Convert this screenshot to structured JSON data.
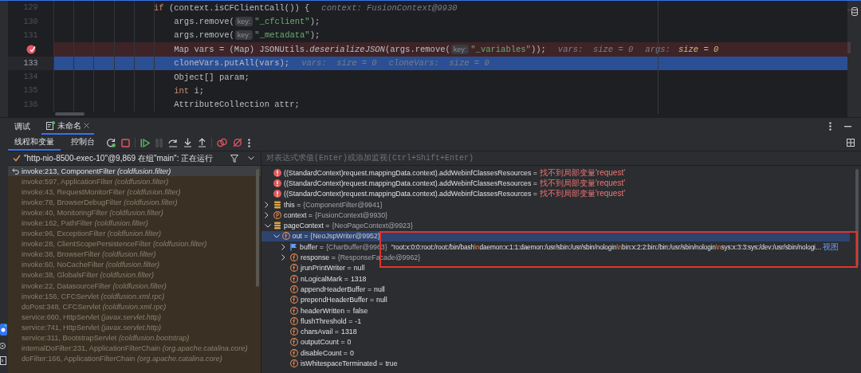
{
  "code_lines": [
    {
      "number": "129",
      "breakpoint": false,
      "current": false,
      "tokens": [
        {
          "kind": "kw",
          "text": "                    if"
        },
        {
          "kind": "plain",
          "text": " (context.isCFClientCall()) {"
        },
        {
          "kind": "inlay",
          "text": "context: FusionContext@9930"
        }
      ]
    },
    {
      "number": "130",
      "breakpoint": false,
      "current": false,
      "tokens": [
        {
          "kind": "plain",
          "text": "                        args.remove("
        },
        {
          "kind": "param",
          "text": "key:"
        },
        {
          "kind": "str",
          "text": "\"_cfclient\""
        },
        {
          "kind": "plain",
          "text": ");"
        }
      ]
    },
    {
      "number": "131",
      "breakpoint": false,
      "current": false,
      "tokens": [
        {
          "kind": "plain",
          "text": "                        args.remove("
        },
        {
          "kind": "param",
          "text": "key:"
        },
        {
          "kind": "str",
          "text": "\"_metadata\""
        },
        {
          "kind": "plain",
          "text": ");"
        }
      ]
    },
    {
      "breakpoint": true,
      "current": false,
      "tokens": [
        {
          "kind": "plain",
          "text": "                        Map vars = (Map) JSONUtils."
        },
        {
          "kind": "method",
          "text": "deserializeJSON"
        },
        {
          "kind": "plain",
          "text": "(args.remove("
        },
        {
          "kind": "param",
          "text": "key:"
        },
        {
          "kind": "str",
          "text": "\"_variables\""
        },
        {
          "kind": "plain",
          "text": "));"
        },
        {
          "kind": "inlay",
          "text": "vars:  size = 0"
        },
        {
          "kind": "inlay",
          "text": "args:"
        },
        {
          "kind": "changed",
          "text": "size = 0"
        }
      ]
    },
    {
      "number": "133",
      "breakpoint": false,
      "current": true,
      "tokens": [
        {
          "kind": "plain",
          "text": "                        cloneVars.putAll(vars);"
        },
        {
          "kind": "inlay",
          "text": "vars:  size = 0"
        },
        {
          "kind": "inlay",
          "text": "cloneVars:  size = 0"
        }
      ]
    },
    {
      "number": "134",
      "breakpoint": false,
      "current": false,
      "tokens": [
        {
          "kind": "plain",
          "text": "                        Object[] param;"
        }
      ]
    },
    {
      "number": "135",
      "breakpoint": false,
      "current": false,
      "tokens": [
        {
          "kind": "kw",
          "text": "                        int"
        },
        {
          "kind": "plain",
          "text": " i;"
        }
      ]
    },
    {
      "number": "136",
      "breakpoint": false,
      "current": false,
      "tokens": [
        {
          "kind": "plain",
          "text": "                        AttributeCollection attr;"
        }
      ]
    }
  ],
  "debug_panel": {
    "title": "调试",
    "tabs": [
      {
        "label": "未命名",
        "selected": true
      }
    ]
  },
  "view_tabs": [
    {
      "label": "线程和变量",
      "selected": true
    },
    {
      "label": "控制台",
      "selected": false
    }
  ],
  "toolbar": [
    {
      "kind": "rerun",
      "disabled": false
    },
    {
      "kind": "stop",
      "disabled": false
    },
    {
      "kind": "separator",
      "disabled": false
    },
    {
      "kind": "resume",
      "disabled": false
    },
    {
      "kind": "pause",
      "disabled": true
    },
    {
      "kind": "step_over",
      "disabled": false
    },
    {
      "kind": "step_into",
      "disabled": false
    },
    {
      "kind": "step_out",
      "disabled": false
    },
    {
      "kind": "separator",
      "disabled": false
    },
    {
      "kind": "breakpoints",
      "disabled": false
    },
    {
      "kind": "mute",
      "disabled": false
    },
    {
      "kind": "more",
      "disabled": false
    }
  ],
  "thread": {
    "text": "\"http-nio-8500-exec-10\"@9,869 在组\"main\": 正在运行"
  },
  "evaluate": {
    "placeholder": "对表达式求值(Enter)或添加监视(Ctrl+Shift+Enter)"
  },
  "frames": [
    {
      "method": "invoke:213, ComponentFilter",
      "package": "(coldfusion.filter)",
      "selected": true
    },
    {
      "method": "invoke:597, ApplicationFilter",
      "package": "(coldfusion.filter)",
      "selected": false
    },
    {
      "method": "invoke:43, RequestMonitorFilter",
      "package": "(coldfusion.filter)",
      "selected": false
    },
    {
      "method": "invoke:78, BrowserDebugFilter",
      "package": "(coldfusion.filter)",
      "selected": false
    },
    {
      "method": "invoke:40, MonitoringFilter",
      "package": "(coldfusion.filter)",
      "selected": false
    },
    {
      "method": "invoke:162, PathFilter",
      "package": "(coldfusion.filter)",
      "selected": false
    },
    {
      "method": "invoke:96, ExceptionFilter",
      "package": "(coldfusion.filter)",
      "selected": false
    },
    {
      "method": "invoke:28, ClientScopePersistenceFilter",
      "package": "(coldfusion.filter)",
      "selected": false
    },
    {
      "method": "invoke:38, BrowserFilter",
      "package": "(coldfusion.filter)",
      "selected": false
    },
    {
      "method": "invoke:60, NoCacheFilter",
      "package": "(coldfusion.filter)",
      "selected": false
    },
    {
      "method": "invoke:38, GlobalsFilter",
      "package": "(coldfusion.filter)",
      "selected": false
    },
    {
      "method": "invoke:22, DatasourceFilter",
      "package": "(coldfusion.filter)",
      "selected": false
    },
    {
      "method": "invoke:156, CFCServlet",
      "package": "(coldfusion.xml.rpc)",
      "selected": false
    },
    {
      "method": "doPost:348, CFCServlet",
      "package": "(coldfusion.xml.rpc)",
      "selected": false
    },
    {
      "method": "service:660, HttpServlet",
      "package": "(javax.servlet.http)",
      "selected": false
    },
    {
      "method": "service:741, HttpServlet",
      "package": "(javax.servlet.http)",
      "selected": false
    },
    {
      "method": "service:311, BootstrapServlet",
      "package": "(coldfusion.bootstrap)",
      "selected": false
    },
    {
      "method": "internalDoFilter:231, ApplicationFilterChain",
      "package": "(org.apache.catalina.core)",
      "selected": false
    },
    {
      "method": "doFilter:166, ApplicationFilterChain",
      "package": "(org.apache.catalina.core)",
      "selected": false
    }
  ],
  "variables": [
    {
      "kind": "error",
      "name": "((StandardContext)request.mappingData.context).addWebinfClassesResources =",
      "value": "找不到局部变量'request'",
      "selected": false
    },
    {
      "kind": "error",
      "name": "((StandardContext)request.mappingData.context).addWebinfClassesResources =",
      "value": "找不到局部变量'request'",
      "selected": false
    },
    {
      "kind": "error",
      "name": "((StandardContext)request.mappingData.context).addWebinfClassesResources =",
      "value": "找不到局部变量'request'",
      "selected": false
    },
    {
      "kind": "static",
      "name": "this =",
      "value": "{ComponentFilter@9941}",
      "expanded": false,
      "selected": false
    },
    {
      "kind": "param",
      "name": "context =",
      "value": "{FusionContext@9930}",
      "expanded": false,
      "selected": false
    },
    {
      "kind": "static",
      "name": "pageContext =",
      "value": "{NeoPageContext@9923}",
      "expanded": true,
      "selected": false,
      "children": [
        {
          "kind": "field",
          "name": "out =",
          "value": "{NeoJspWriter@9952}",
          "expanded": true,
          "selected": true,
          "highlighted": true,
          "children": [
            {
              "kind": "flag",
              "name": "buffer =",
              "value": "{CharBuffer@9963}",
              "expanded": false,
              "selected": false,
              "value_segments": [
                {
                  "text": "\"root:x:0:0:root:/root:/bin/bash",
                  "escape": false
                },
                {
                  "text": "\\n",
                  "escape": true
                },
                {
                  "text": "daemon:x:1:1:daemon:/usr/sbin:/usr/sbin/nologin",
                  "escape": false
                },
                {
                  "text": "\\n",
                  "escape": true
                },
                {
                  "text": "bin:x:2:2:bin:/bin:/usr/sbin/nologin",
                  "escape": false
                },
                {
                  "text": "\\n",
                  "escape": true
                },
                {
                  "text": "sys:x:3:3:sys:/dev:/usr/sbin/nologi…",
                  "escape": false
                }
              ],
              "link": "视图"
            },
            {
              "kind": "field",
              "name": "response =",
              "value": "{ResponseFacade@9962}",
              "expanded": false,
              "selected": false
            },
            {
              "kind": "field",
              "name": "jrunPrintWriter =",
              "value": "null",
              "selected": false
            },
            {
              "kind": "field",
              "name": "nLogicalMark =",
              "value": "1318",
              "selected": false
            },
            {
              "kind": "field",
              "name": "appendHeaderBuffer =",
              "value": "null",
              "selected": false
            },
            {
              "kind": "field",
              "name": "prependHeaderBuffer =",
              "value": "null",
              "selected": false
            },
            {
              "kind": "field",
              "name": "headerWritten =",
              "value": "false",
              "selected": false
            },
            {
              "kind": "field",
              "name": "flushThreshold =",
              "value": "-1",
              "selected": false
            },
            {
              "kind": "field",
              "name": "charsAvail =",
              "value": "1318",
              "selected": false
            },
            {
              "kind": "field",
              "name": "outputCount =",
              "value": "0",
              "selected": false
            },
            {
              "kind": "field",
              "name": "disableCount =",
              "value": "0",
              "selected": false
            },
            {
              "kind": "field",
              "name": "isWhitespaceTerminated =",
              "value": "true",
              "selected": false
            }
          ]
        }
      ]
    }
  ]
}
